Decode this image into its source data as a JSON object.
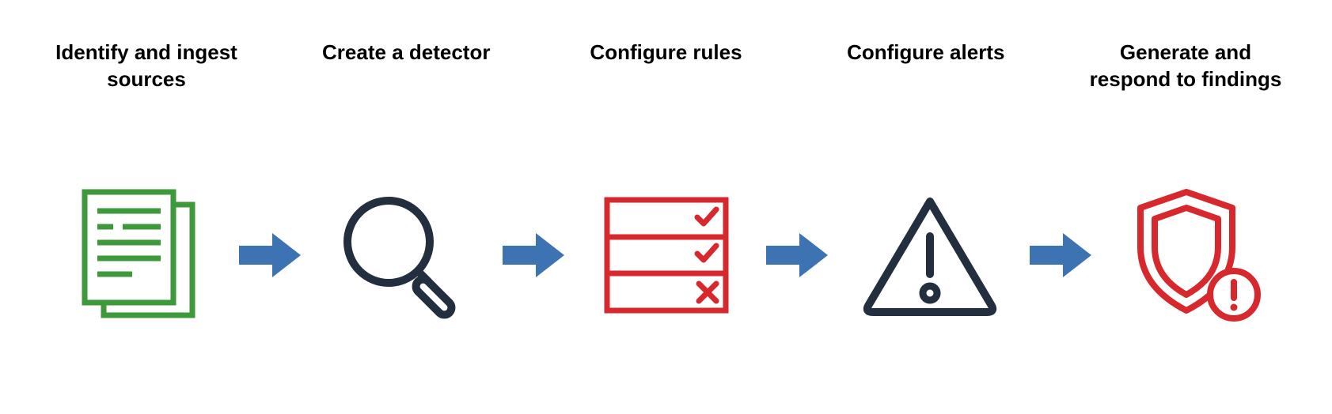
{
  "steps": [
    {
      "label": "Identify and ingest sources",
      "icon": "documents-icon",
      "color": "#3D9939"
    },
    {
      "label": "Create a detector",
      "icon": "magnifier-icon",
      "color": "#232F3E"
    },
    {
      "label": "Configure rules",
      "icon": "rules-checklist-icon",
      "color": "#D7282E"
    },
    {
      "label": "Configure alerts",
      "icon": "warning-triangle-icon",
      "color": "#232F3E"
    },
    {
      "label": "Generate and respond to findings",
      "icon": "shield-alert-icon",
      "color": "#D7282E"
    }
  ],
  "colors": {
    "arrow": "#3E73B3",
    "green": "#3D9939",
    "navy": "#232F3E",
    "red": "#D7282E"
  }
}
